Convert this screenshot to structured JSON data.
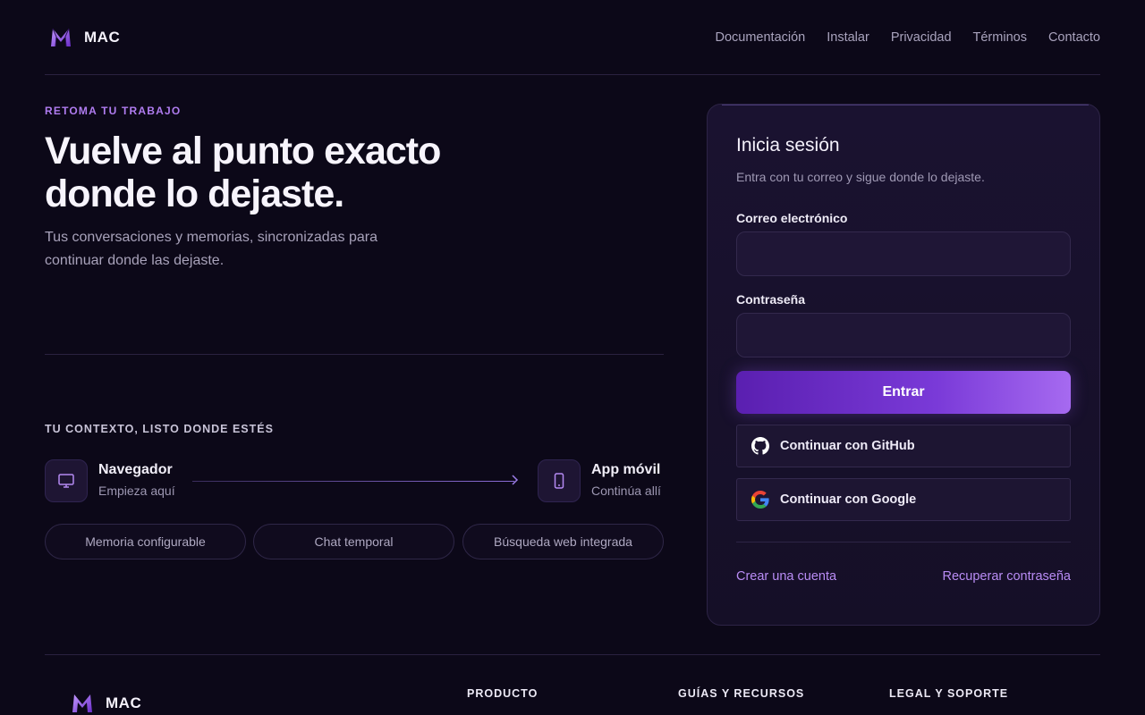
{
  "header": {
    "brand": "MAC",
    "nav": [
      "Documentación",
      "Instalar",
      "Privacidad",
      "Términos",
      "Contacto"
    ]
  },
  "hero": {
    "eyebrow": "RETOMA TU TRABAJO",
    "title_line1": "Vuelve al punto exacto",
    "title_line2": "donde lo dejaste.",
    "subtitle": "Tus conversaciones y memorias, sincronizadas para continuar donde las dejaste."
  },
  "context": {
    "title": "TU CONTEXTO, LISTO DONDE ESTÉS",
    "from": {
      "name": "Navegador",
      "sub": "Empieza aquí",
      "icon": "monitor-icon"
    },
    "to": {
      "name": "App móvil",
      "sub": "Continúa allí",
      "icon": "smartphone-icon"
    },
    "features": [
      "Memoria configurable",
      "Chat temporal",
      "Búsqueda web integrada"
    ]
  },
  "login": {
    "title": "Inicia sesión",
    "subtitle": "Entra con tu correo y sigue donde lo dejaste.",
    "email_label": "Correo electrónico",
    "email_value": "",
    "password_label": "Contraseña",
    "password_value": "",
    "submit": "Entrar",
    "github": "Continuar con GitHub",
    "google": "Continuar con Google",
    "create_account": "Crear una cuenta",
    "recover_password": "Recuperar contraseña"
  },
  "footer": {
    "brand": "MAC",
    "columns": [
      "PRODUCTO",
      "GUÍAS Y RECURSOS",
      "LEGAL Y SOPORTE"
    ]
  },
  "colors": {
    "background": "#0c0818",
    "accent": "#b07cf0",
    "primary_button_start": "#5a1fb0",
    "primary_button_end": "#a66af0"
  }
}
